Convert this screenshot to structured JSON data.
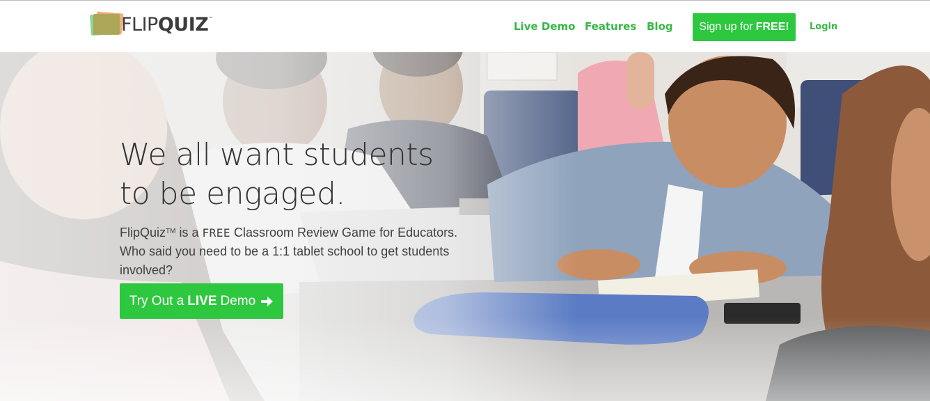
{
  "header": {
    "logo": {
      "light": "FLIP",
      "bold": "QUIZ",
      "tm": "™"
    },
    "nav": {
      "live_demo": "Live Demo",
      "features": "Features",
      "blog": "Blog",
      "signup_prefix": "Sign up for",
      "signup_strong": "FREE!",
      "login": "Login"
    }
  },
  "hero": {
    "headline_line1": "We all want students",
    "headline_line2": "to be engaged.",
    "sub_brand": "FlipQuiz",
    "sub_tm": "TM",
    "sub_is_a": " is a ",
    "sub_free": "FREE",
    "sub_rest": " Classroom Review Game for Educators. Who said you need to be a 1:1 tablet school to get students involved?",
    "cta_prefix": "Try Out a",
    "cta_strong": "LIVE",
    "cta_suffix": "Demo",
    "cta_icon": "arrow-right-icon"
  },
  "colors": {
    "accent": "#2dc83f",
    "nav_link": "#36b845",
    "text_dark": "#333333",
    "logo_text": "#3c3c3c"
  }
}
